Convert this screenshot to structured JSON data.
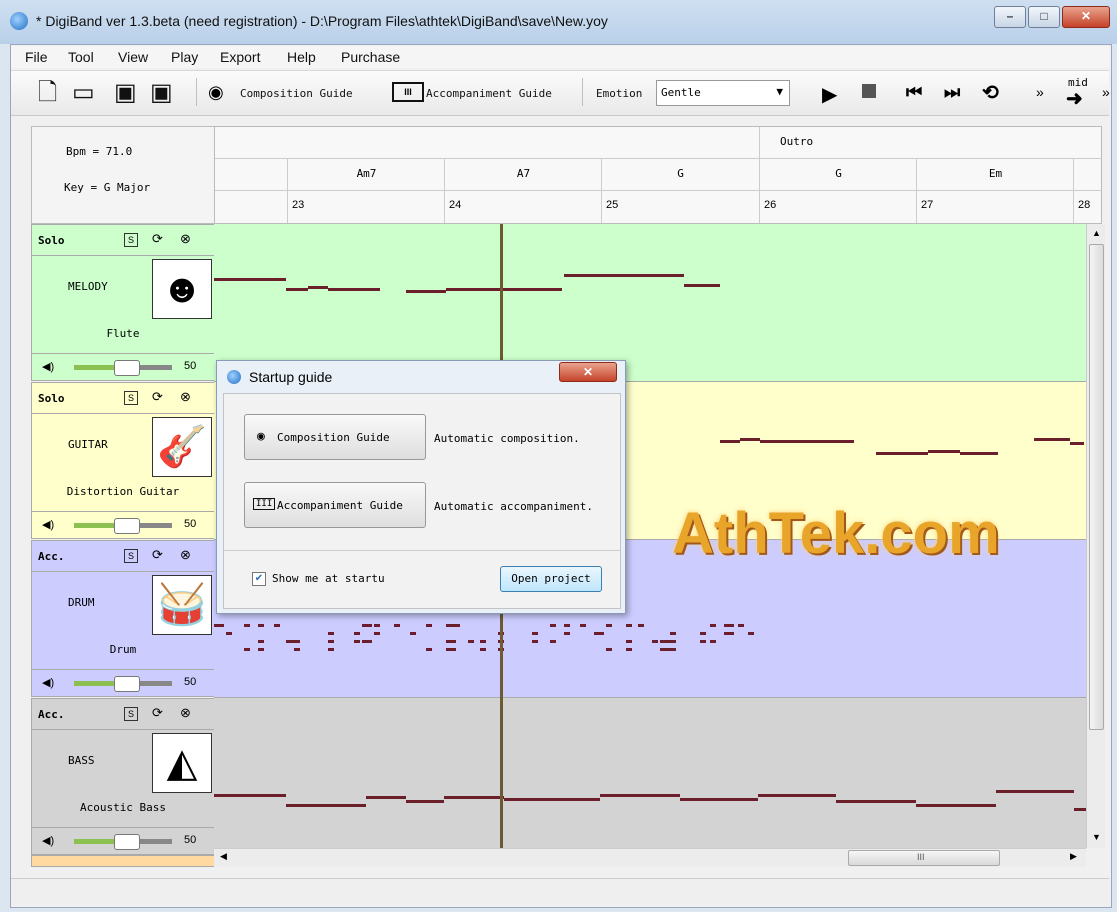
{
  "window": {
    "title": "* DigiBand ver 1.3.beta (need registration)  -  D:\\Program Files\\athtek\\DigiBand\\save\\New.yoy",
    "minimize_glyph": "–",
    "maximize_glyph": "□",
    "close_glyph": "✕"
  },
  "menu": [
    "File",
    "Tool",
    "View",
    "Play",
    "Export",
    "Help",
    "Purchase"
  ],
  "toolbar": {
    "composition_guide": "Composition Guide",
    "accompaniment_guide": "Accompaniment Guide",
    "emotion_label": "Emotion",
    "emotion_value": "Gentle",
    "more_glyph": "»",
    "mid_label": "mid"
  },
  "info": {
    "bpm": "Bpm = 71.0",
    "key": "Key =  G  Major"
  },
  "timeline": {
    "section": "Outro",
    "chords": [
      "Am7",
      "A7",
      "G",
      "G",
      "Em"
    ],
    "measures": [
      "23",
      "24",
      "25",
      "26",
      "27",
      "28"
    ]
  },
  "tracks": [
    {
      "role": "Solo",
      "name": "MELODY",
      "instrument": "Flute",
      "volume": "50",
      "color": "#ccffcc",
      "icon": "singer-icon"
    },
    {
      "role": "Solo",
      "name": "GUITAR",
      "instrument": "Distortion Guitar",
      "volume": "50",
      "color": "#ffffcc",
      "icon": "guitar-icon"
    },
    {
      "role": "Acc.",
      "name": "DRUM",
      "instrument": "Drum",
      "volume": "50",
      "color": "#ccccff",
      "icon": "drum-icon"
    },
    {
      "role": "Acc.",
      "name": "BASS",
      "instrument": "Acoustic Bass",
      "volume": "50",
      "color": "#d3d3d3",
      "icon": "bass-icon"
    }
  ],
  "dialog": {
    "title": "Startup guide",
    "composition_button": "Composition Guide",
    "composition_desc": "Automatic composition.",
    "accompaniment_button": "Accompaniment Guide",
    "accompaniment_desc": "Automatic accompaniment.",
    "show_at_startup": "Show me at startu",
    "show_at_startup_checked": true,
    "open_project": "Open project"
  },
  "watermark": "AthTek.com",
  "hscroll_grip": "III"
}
